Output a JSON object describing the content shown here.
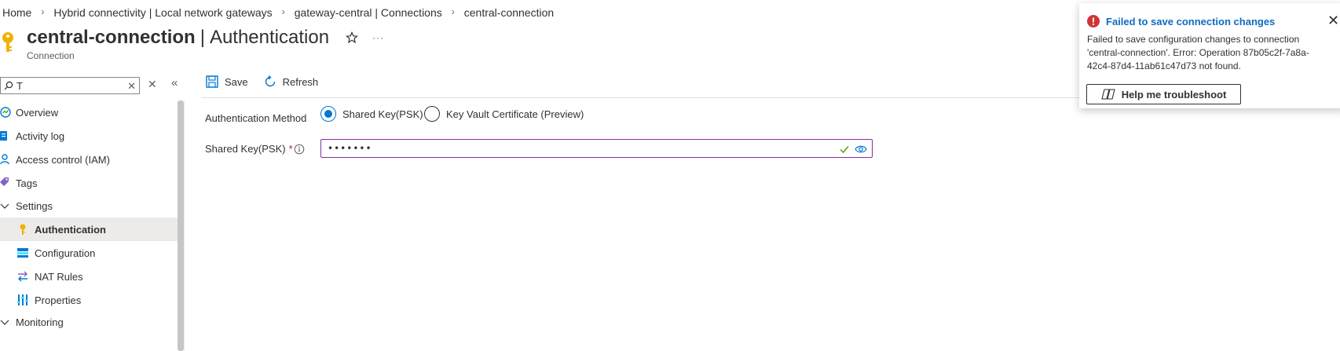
{
  "breadcrumb": {
    "items": [
      "Home",
      "Hybrid connectivity | Local network gateways",
      "gateway-central | Connections",
      "central-connection"
    ]
  },
  "header": {
    "name": "central-connection",
    "pipe": "|",
    "section": "Authentication",
    "subtitle": "Connection",
    "favorite_icon": "star-icon",
    "more_icon": "ellipsis-icon",
    "more_glyph": "···"
  },
  "sidebar": {
    "search_value": "T",
    "items": [
      {
        "label": "Overview",
        "icon": "overview-icon"
      },
      {
        "label": "Activity log",
        "icon": "activity-log-icon"
      },
      {
        "label": "Access control (IAM)",
        "icon": "iam-icon"
      },
      {
        "label": "Tags",
        "icon": "tag-icon"
      },
      {
        "label": "Settings",
        "icon": "chevron-down-icon"
      },
      {
        "label": "Authentication",
        "icon": "key-icon"
      },
      {
        "label": "Configuration",
        "icon": "configuration-icon"
      },
      {
        "label": "NAT Rules",
        "icon": "nat-rules-icon"
      },
      {
        "label": "Properties",
        "icon": "properties-icon"
      },
      {
        "label": "Monitoring",
        "icon": "chevron-down-icon"
      }
    ]
  },
  "toolbar": {
    "save_label": "Save",
    "refresh_label": "Refresh"
  },
  "form": {
    "auth_method_label": "Authentication Method",
    "option_psk": "Shared Key(PSK)",
    "option_kv": "Key Vault Certificate (Preview)",
    "selected": "Shared Key(PSK)",
    "psk_label": "Shared Key(PSK)",
    "required_mark": "*",
    "psk_value": "•••••••"
  },
  "toast": {
    "title": "Failed to save connection changes",
    "body": "Failed to save configuration changes to connection 'central-connection'. Error: Operation 87b05c2f-7a8a-42c4-87d4-11ab61c47d73 not found.",
    "button": "Help me troubleshoot"
  },
  "colors": {
    "accent": "#0078d4",
    "error": "#d13438",
    "focus_border": "#8a2da5",
    "key_yellow": "#f2b100"
  }
}
